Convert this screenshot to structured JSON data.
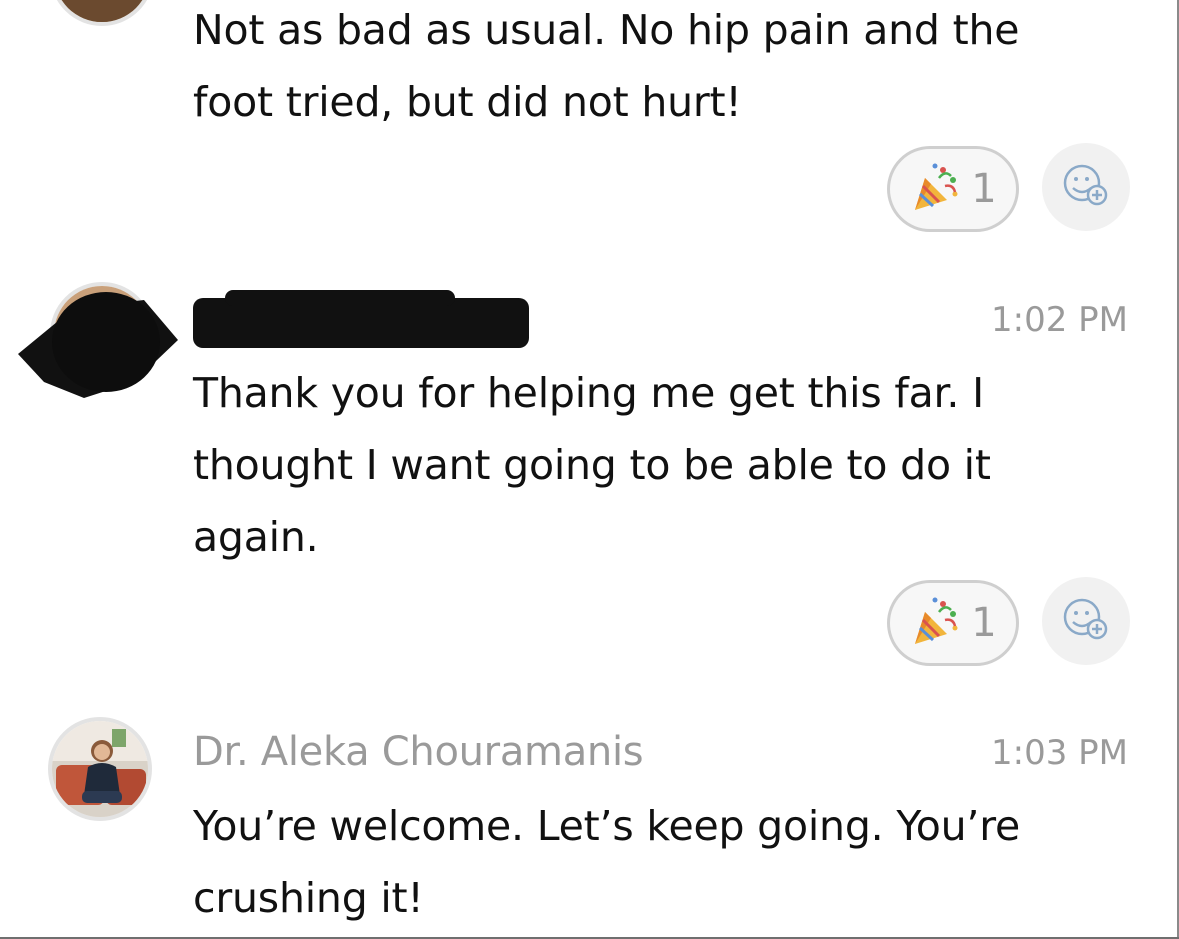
{
  "messages": [
    {
      "text": "Not as bad as usual. No hip pain and the foot tried, but did not hurt!",
      "reaction": {
        "emoji": "party-popper-icon",
        "count": "1"
      }
    },
    {
      "sender": "",
      "time": "1:02 PM",
      "text": "Thank you for helping me get this far. I thought I want going to be able to do it again.",
      "reaction": {
        "emoji": "party-popper-icon",
        "count": "1"
      }
    },
    {
      "sender": "Dr. Aleka Chouramanis",
      "time": "1:03 PM",
      "text": "You’re welcome. Let’s keep going. You’re crushing it!"
    }
  ],
  "colors": {
    "text": "#111111",
    "muted": "#9a9a9a",
    "pill_border": "#cfcfcf",
    "add_bg": "#f1f1f1"
  }
}
